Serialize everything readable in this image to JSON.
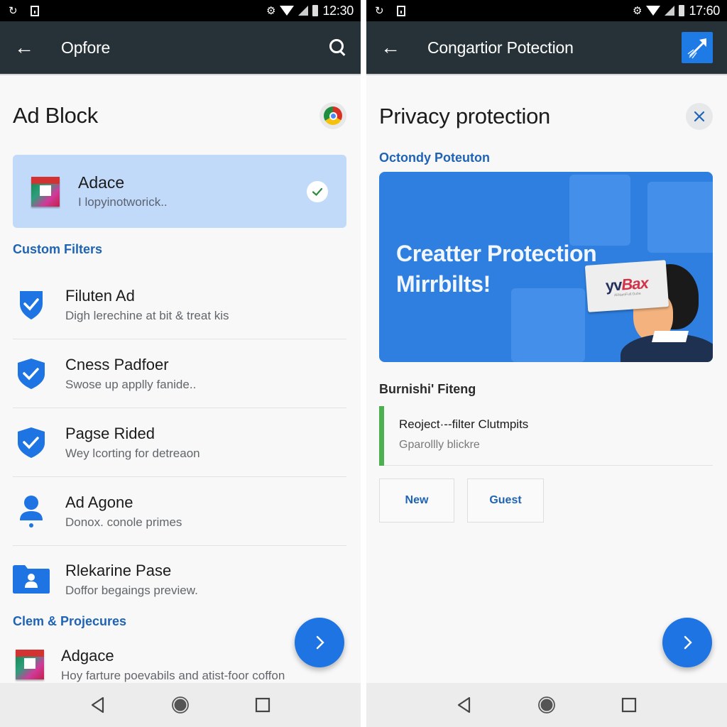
{
  "left_screen": {
    "status_bar": {
      "time": "12:30",
      "left_icons": [
        "sync-icon",
        "sim-card-icon"
      ],
      "right_icons": [
        "settings-icon",
        "wifi-icon",
        "signal-icon",
        "battery-icon"
      ]
    },
    "app_bar": {
      "back_icon": "arrow-left",
      "title": "Opfore",
      "action_icon": "search-icon"
    },
    "page_title": "Ad Block",
    "browser_icon": "chrome-icon",
    "selected_card": {
      "title": "Adace",
      "subtitle": "I lopyinotworick..",
      "status_icon": "check-icon",
      "selected": true
    },
    "section_custom_filters": "Custom Filters",
    "filters": [
      {
        "icon": "shield-check-icon",
        "title": "Filuten Ad",
        "subtitle": "Digh lerechine at bit & treat kis"
      },
      {
        "icon": "shield-check-icon",
        "title": "Cness Padfoer",
        "subtitle": "Swose up applly fanide.."
      },
      {
        "icon": "shield-check-icon",
        "title": "Pagse Rided",
        "subtitle": "Wey lcorting for detreaon"
      },
      {
        "icon": "person-icon",
        "title": "Ad Agone",
        "subtitle": "Donox. conole primes"
      },
      {
        "icon": "folder-user-icon",
        "title": "Rlekarine Pase",
        "subtitle": "Doffor begaings preview."
      }
    ],
    "section_projects": "Clem & Projecures",
    "project_item": {
      "title": "Adgace",
      "subtitle": "Hoy farture poevabils and atist-foor coffon"
    },
    "fab_icon": "chevron-right-icon"
  },
  "right_screen": {
    "status_bar": {
      "time": "17:60",
      "left_icons": [
        "sync-icon",
        "sim-card-icon"
      ],
      "right_icons": [
        "settings-icon",
        "wifi-icon",
        "signal-icon",
        "battery-icon"
      ]
    },
    "app_bar": {
      "back_icon": "arrow-left",
      "title": "Congartior Potection",
      "action_icon": "app-logo-icon"
    },
    "page_title": "Privacy protection",
    "close_icon": "close-icon",
    "subtitle": "Octondy Poteuton",
    "banner": {
      "headline_line1": "Creatter Protection",
      "headline_line2": "Mirrbilts!",
      "card_logo_a": "yv",
      "card_logo_b": "Bax",
      "card_tagline": "AliNamFull.Gube"
    },
    "section_filtering": "Burnishi' Fiteng",
    "filter_row": {
      "title": "Reoject·--filter Clutmpits",
      "subtitle": "Gparollly blickre",
      "accent_color": "#4caf50"
    },
    "buttons": {
      "new": "New",
      "guest": "Guest"
    },
    "fab_icon": "chevron-right-icon"
  },
  "nav_bar": {
    "back": "back-triangle-icon",
    "home": "home-circle-icon",
    "recents": "recents-square-icon"
  },
  "colors": {
    "appbar": "#263238",
    "accent_blue": "#1e74e3",
    "section_blue": "#1f63b5",
    "selected_card": "#c2dafa",
    "banner": "#2f7fe0"
  }
}
